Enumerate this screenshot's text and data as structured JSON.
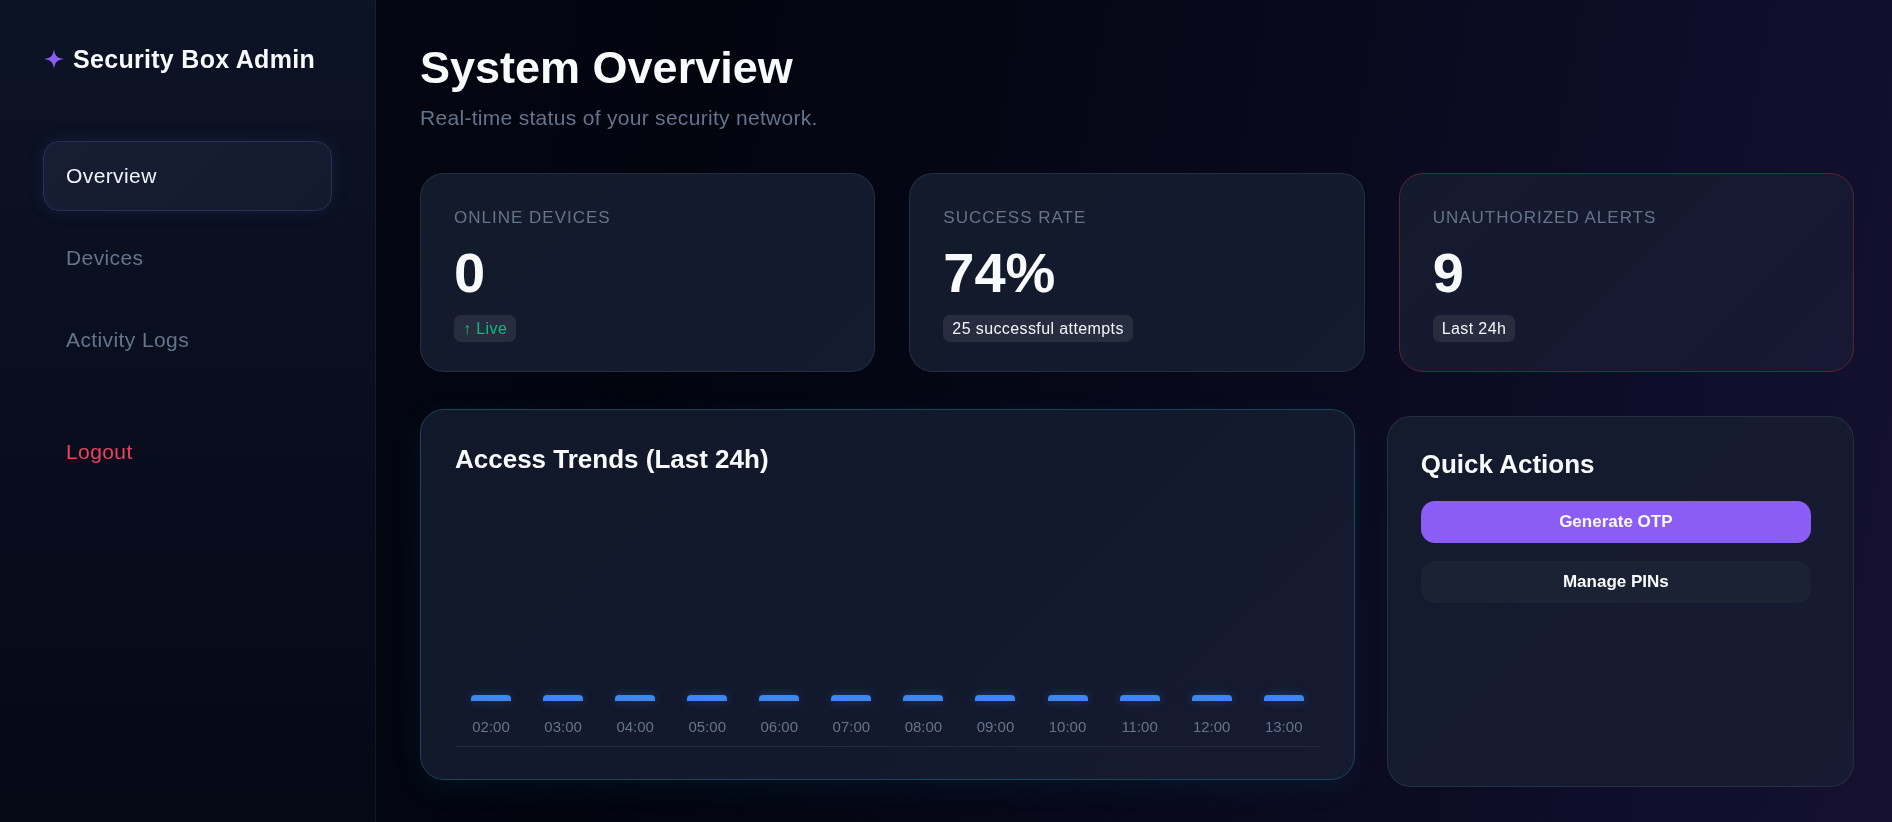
{
  "sidebar": {
    "brand": "Security Box Admin",
    "items": [
      {
        "label": "Overview",
        "selected": true
      },
      {
        "label": "Devices",
        "selected": false
      },
      {
        "label": "Activity Logs",
        "selected": false
      }
    ],
    "logout": "Logout"
  },
  "header": {
    "title": "System Overview",
    "subtitle": "Real-time status of your security network."
  },
  "stats": [
    {
      "label": "ONLINE DEVICES",
      "value": "0",
      "badge": {
        "text": "↑ Live",
        "color": "#10b981"
      },
      "alert": false
    },
    {
      "label": "SUCCESS RATE",
      "value": "74%",
      "badge": {
        "text": "25 successful attempts",
        "color": "#f1f5f9"
      },
      "alert": false
    },
    {
      "label": "UNAUTHORIZED ALERTS",
      "value": "9",
      "badge": {
        "text": "Last 24h",
        "color": "#f1f5f9"
      },
      "alert": true
    }
  ],
  "access_trends": {
    "title": "Access Trends (Last 24h)",
    "hours": [
      "02:00",
      "03:00",
      "04:00",
      "05:00",
      "06:00",
      "07:00",
      "08:00",
      "09:00",
      "10:00",
      "11:00",
      "12:00",
      "13:00"
    ]
  },
  "quick_actions": {
    "title": "Quick Actions",
    "buttons": [
      {
        "label": "Generate OTP",
        "kind": "primary"
      },
      {
        "label": "Manage PINs",
        "kind": "secondary"
      }
    ]
  }
}
